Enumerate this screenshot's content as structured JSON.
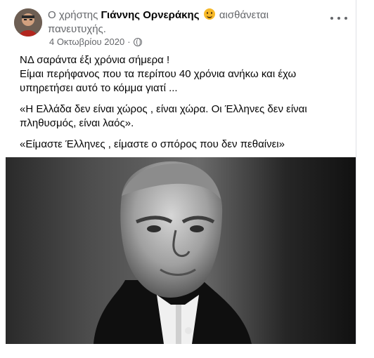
{
  "post": {
    "prefix": "Ο χρήστης",
    "author": "Γιάννης Ορνεράκης",
    "feeling_text": "αισθάνεται",
    "feeling_line2": "πανευτυχής.",
    "date": "4 Οκτωβρίου 2020",
    "separator": "·",
    "paragraphs": [
      "ΝΔ σαράντα έξι  χρόνια σήμερα !",
      "Είμαι περήφανος που τα περίπου 40 χρόνια ανήκω και έχω υπηρετήσει αυτό το κόμμα γιατί ...",
      "«Η Ελλάδα δεν είναι χώρος , είναι χώρα. Οι Έλληνες δεν είναι πληθυσμός, είναι λαός».",
      "«Είμαστε Έλληνες , είμαστε ο σπόρος που δεν πεθαίνει»"
    ]
  },
  "icons": {
    "emoji": "happy-face-icon",
    "privacy": "globe-icon",
    "menu": "more-horizontal-icon"
  },
  "colors": {
    "text": "#050505",
    "secondary": "#65676b",
    "emoji": "#f7b928"
  }
}
